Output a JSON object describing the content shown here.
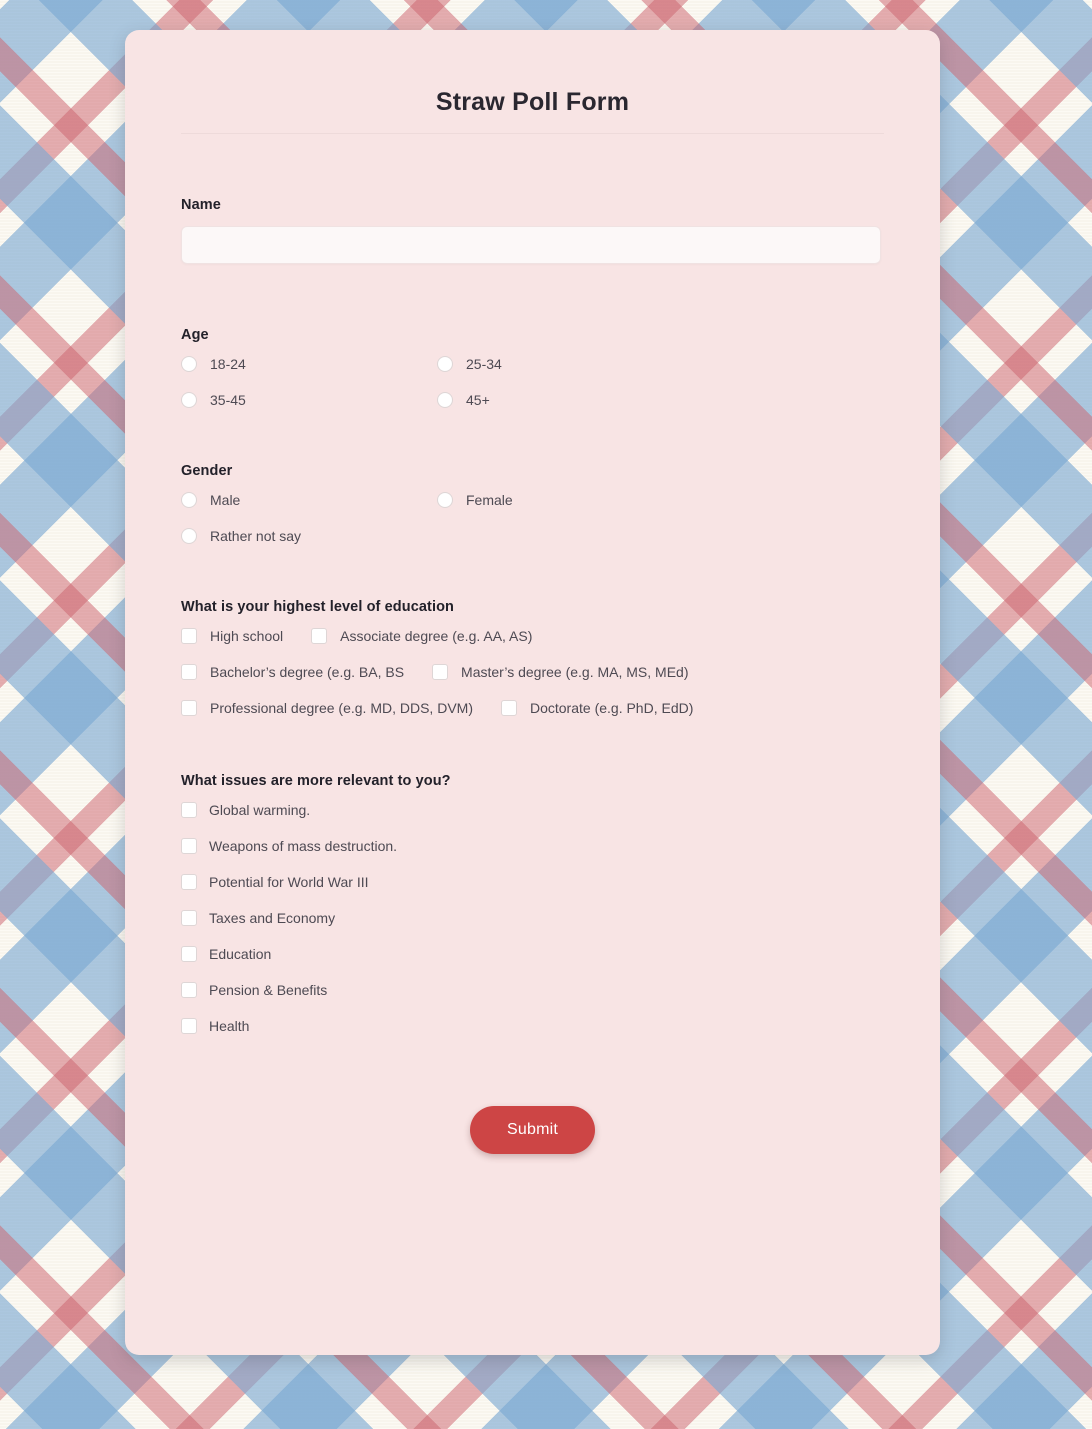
{
  "form": {
    "title": "Straw Poll Form",
    "submit_label": "Submit",
    "accent_color": "#cd4545",
    "card_color": "#f8e4e4",
    "fields": {
      "name": {
        "label": "Name",
        "value": "",
        "placeholder": ""
      },
      "age": {
        "label": "Age",
        "type": "radio",
        "options": [
          {
            "label": "18-24",
            "selected": false
          },
          {
            "label": "25-34",
            "selected": false
          },
          {
            "label": "35-45",
            "selected": false
          },
          {
            "label": "45+",
            "selected": false
          }
        ]
      },
      "gender": {
        "label": "Gender",
        "type": "radio",
        "options": [
          {
            "label": "Male",
            "selected": false
          },
          {
            "label": "Female",
            "selected": false
          },
          {
            "label": "Rather not say",
            "selected": false
          }
        ]
      },
      "education": {
        "label": "What is your highest level of education",
        "type": "checkbox",
        "options": [
          {
            "label": "High school",
            "checked": false
          },
          {
            "label": "Associate degree (e.g. AA, AS)",
            "checked": false
          },
          {
            "label": "Bachelor’s degree (e.g. BA, BS",
            "checked": false
          },
          {
            "label": "Master’s degree (e.g. MA, MS, MEd)",
            "checked": false
          },
          {
            "label": "Professional degree (e.g. MD, DDS, DVM)",
            "checked": false
          },
          {
            "label": "Doctorate (e.g. PhD, EdD)",
            "checked": false
          }
        ]
      },
      "issues": {
        "label": "What issues are more relevant to you?",
        "type": "checkbox",
        "options": [
          {
            "label": "Global warming.",
            "checked": false
          },
          {
            "label": "Weapons of mass destruction.",
            "checked": false
          },
          {
            "label": "Potential for World War III",
            "checked": false
          },
          {
            "label": "Taxes and Economy",
            "checked": false
          },
          {
            "label": "Education",
            "checked": false
          },
          {
            "label": "Pension & Benefits",
            "checked": false
          },
          {
            "label": "Health",
            "checked": false
          }
        ]
      }
    }
  }
}
